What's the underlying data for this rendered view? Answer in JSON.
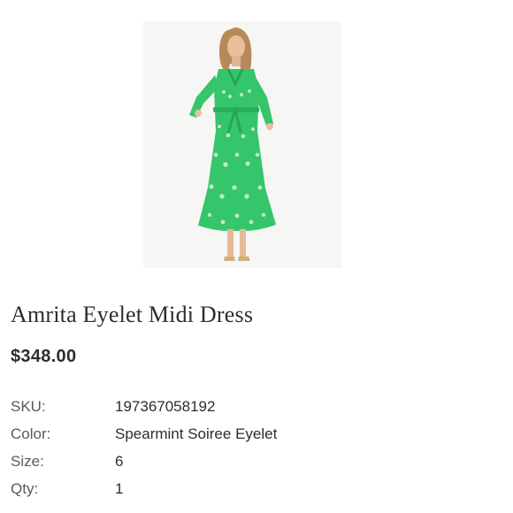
{
  "product": {
    "image_alt": "Green eyelet midi dress",
    "title": "Amrita Eyelet Midi Dress",
    "price": "$348.00"
  },
  "details": [
    {
      "label": "SKU:",
      "value": "197367058192"
    },
    {
      "label": "Color:",
      "value": "Spearmint Soiree Eyelet"
    },
    {
      "label": "Size:",
      "value": "6"
    },
    {
      "label": "Qty:",
      "value": "1"
    }
  ],
  "colors": {
    "dress": "#35c56a",
    "text": "#2d2d2d",
    "background": "#ffffff"
  }
}
